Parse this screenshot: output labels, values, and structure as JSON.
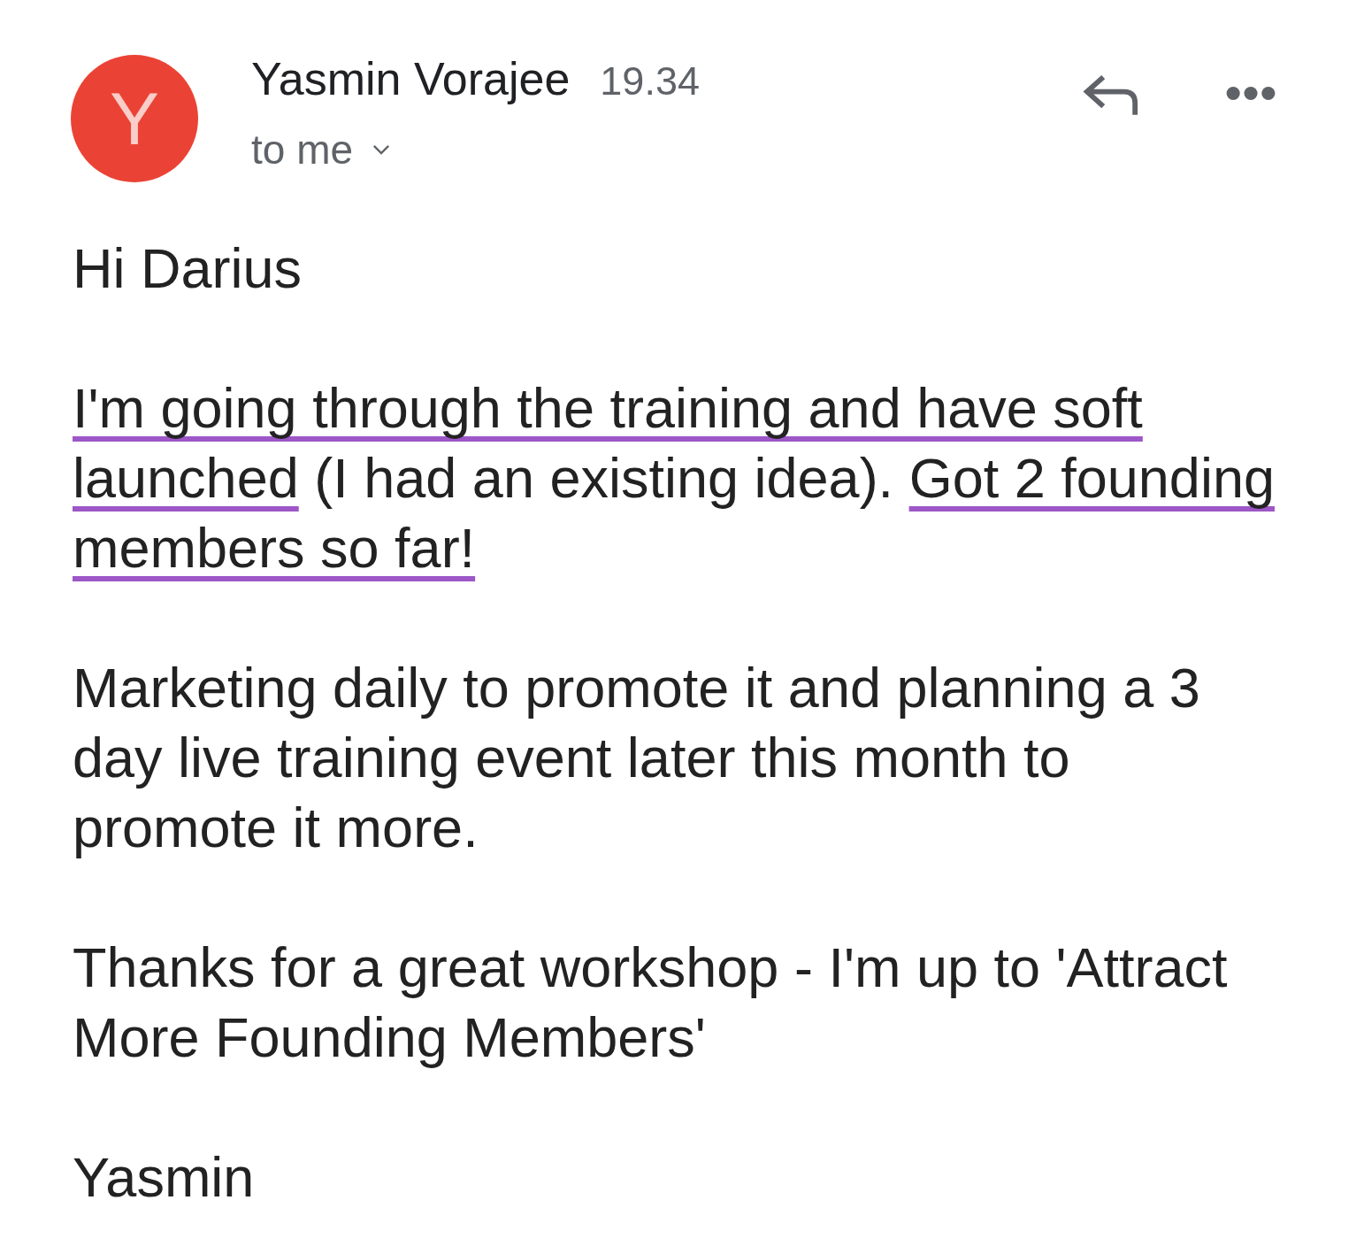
{
  "header": {
    "avatar_letter": "Y",
    "sender": "Yasmin Vorajee",
    "time": "19.34",
    "recipients": "to me"
  },
  "body": {
    "paragraphs": [
      {
        "segments": [
          {
            "text": "Hi Darius",
            "underlined": false
          }
        ]
      },
      {
        "segments": [
          {
            "text": "I'm going through the training and have soft launched",
            "underlined": true
          },
          {
            "text": " (I had an existing idea). ",
            "underlined": false
          },
          {
            "text": "Got 2 founding members so far!",
            "underlined": true
          }
        ]
      },
      {
        "segments": [
          {
            "text": "Marketing daily to promote it and planning a 3 day live training event later this month to promote it more.",
            "underlined": false
          }
        ]
      },
      {
        "segments": [
          {
            "text": "Thanks for a great workshop - I'm up to 'Attract More Founding Members'",
            "underlined": false
          }
        ]
      },
      {
        "segments": [
          {
            "text": "Yasmin",
            "underlined": false
          }
        ]
      }
    ]
  }
}
